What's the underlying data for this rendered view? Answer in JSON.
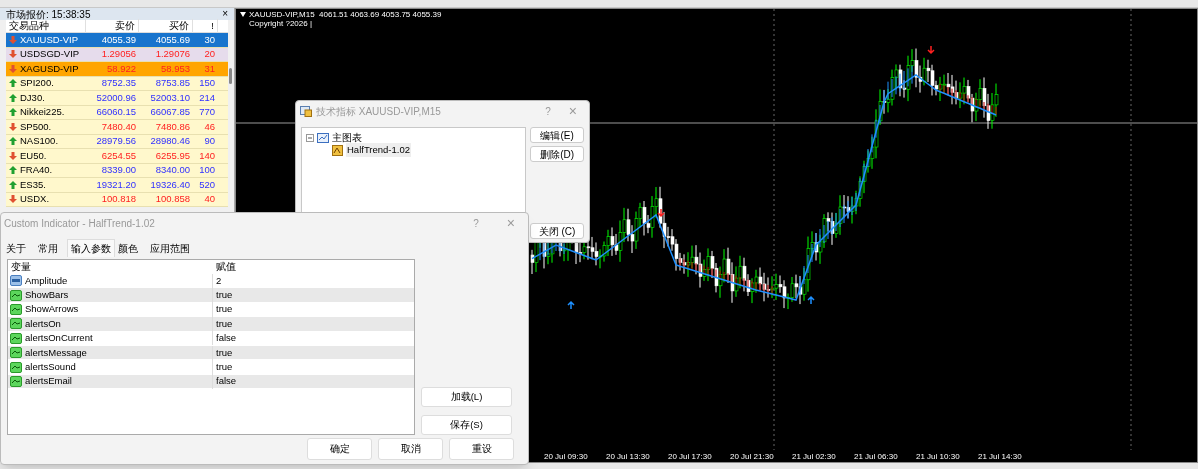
{
  "market_watch": {
    "title": "市场报价: 15:38:35",
    "close": "×",
    "columns": [
      "交易品种",
      "卖价",
      "买价",
      "!"
    ],
    "rows": [
      {
        "symbol": "XAUUSD-VIP",
        "bid": "4055.39",
        "ask": "4055.69",
        "spread": "30",
        "kind": "down",
        "selected": true,
        "color": "#1874cd"
      },
      {
        "symbol": "USDSGD-VIP",
        "bid": "1.29056",
        "ask": "1.29076",
        "spread": "20",
        "kind": "down",
        "selected": false,
        "color": "#e6dcec"
      },
      {
        "symbol": "XAGUSD-VIP",
        "bid": "58.922",
        "ask": "58.953",
        "spread": "31",
        "kind": "down",
        "selected": false,
        "color": "#ffa500"
      },
      {
        "symbol": "SPI200.",
        "bid": "8752.35",
        "ask": "8753.85",
        "spread": "150",
        "kind": "up",
        "selected": false,
        "color": "#fff8cc"
      },
      {
        "symbol": "DJ30.",
        "bid": "52000.96",
        "ask": "52003.10",
        "spread": "214",
        "kind": "up",
        "selected": false,
        "color": "#fff8cc"
      },
      {
        "symbol": "Nikkei225.",
        "bid": "66060.15",
        "ask": "66067.85",
        "spread": "770",
        "kind": "up",
        "selected": false,
        "color": "#fff8cc"
      },
      {
        "symbol": "SP500.",
        "bid": "7480.40",
        "ask": "7480.86",
        "spread": "46",
        "kind": "down",
        "selected": false,
        "color": "#fff8cc"
      },
      {
        "symbol": "NAS100.",
        "bid": "28979.56",
        "ask": "28980.46",
        "spread": "90",
        "kind": "up",
        "selected": false,
        "color": "#fff8cc"
      },
      {
        "symbol": "EU50.",
        "bid": "6254.55",
        "ask": "6255.95",
        "spread": "140",
        "kind": "down",
        "selected": false,
        "color": "#fff8cc"
      },
      {
        "symbol": "FRA40.",
        "bid": "8339.00",
        "ask": "8340.00",
        "spread": "100",
        "kind": "up",
        "selected": false,
        "color": "#fff8cc"
      },
      {
        "symbol": "ES35.",
        "bid": "19321.20",
        "ask": "19326.40",
        "spread": "520",
        "kind": "up",
        "selected": false,
        "color": "#fff8cc"
      },
      {
        "symbol": "USDX.",
        "bid": "100.818",
        "ask": "100.858",
        "spread": "40",
        "kind": "down",
        "selected": false,
        "color": "#fff8cc"
      }
    ]
  },
  "chart": {
    "symbol_line": "XAUUSD-VIP,M15  4061.51 4063.69 4053.75 4055.39",
    "copyright": "Copyright ?2026 |",
    "time_labels": [
      "20 Jul 09:30",
      "20 Jul 13:30",
      "20 Jul 17:30",
      "20 Jul 21:30",
      "21 Jul 02:30",
      "21 Jul 06:30",
      "21 Jul 10:30",
      "21 Jul 14:30"
    ]
  },
  "indicators_dialog": {
    "title": "技术指标 XAUUSD-VIP,M15",
    "help": "?",
    "close": "×",
    "tree": [
      {
        "label": "主图表",
        "expanded": true,
        "children": [
          {
            "label": "HalfTrend-1.02"
          }
        ]
      }
    ],
    "buttons": [
      "编辑(E)",
      "删除(D)"
    ],
    "close_button": "关闭 (C)"
  },
  "custom_indicator_dialog": {
    "title": "Custom Indicator - HalfTrend-1.02",
    "help": "?",
    "close": "×",
    "tabs": [
      {
        "label": "关于",
        "selected": false
      },
      {
        "label": "常用",
        "selected": false
      },
      {
        "label": "输入参数",
        "selected": true
      },
      {
        "label": "颜色",
        "selected": false
      },
      {
        "label": "应用范围",
        "selected": false
      }
    ],
    "columns": [
      "变量",
      "赋值"
    ],
    "params": [
      {
        "name": "Amplitude",
        "value": "2",
        "kind": "number"
      },
      {
        "name": "ShowBars",
        "value": "true",
        "kind": "bool"
      },
      {
        "name": "ShowArrows",
        "value": "true",
        "kind": "bool"
      },
      {
        "name": "alertsOn",
        "value": "true",
        "kind": "bool"
      },
      {
        "name": "alertsOnCurrent",
        "value": "false",
        "kind": "bool"
      },
      {
        "name": "alertsMessage",
        "value": "true",
        "kind": "bool"
      },
      {
        "name": "alertsSound",
        "value": "true",
        "kind": "bool"
      },
      {
        "name": "alertsEmail",
        "value": "false",
        "kind": "bool"
      }
    ],
    "side_buttons": [
      "加载(L)",
      "保存(S)"
    ],
    "bottom_buttons": [
      "确定",
      "取消",
      "重设"
    ]
  }
}
